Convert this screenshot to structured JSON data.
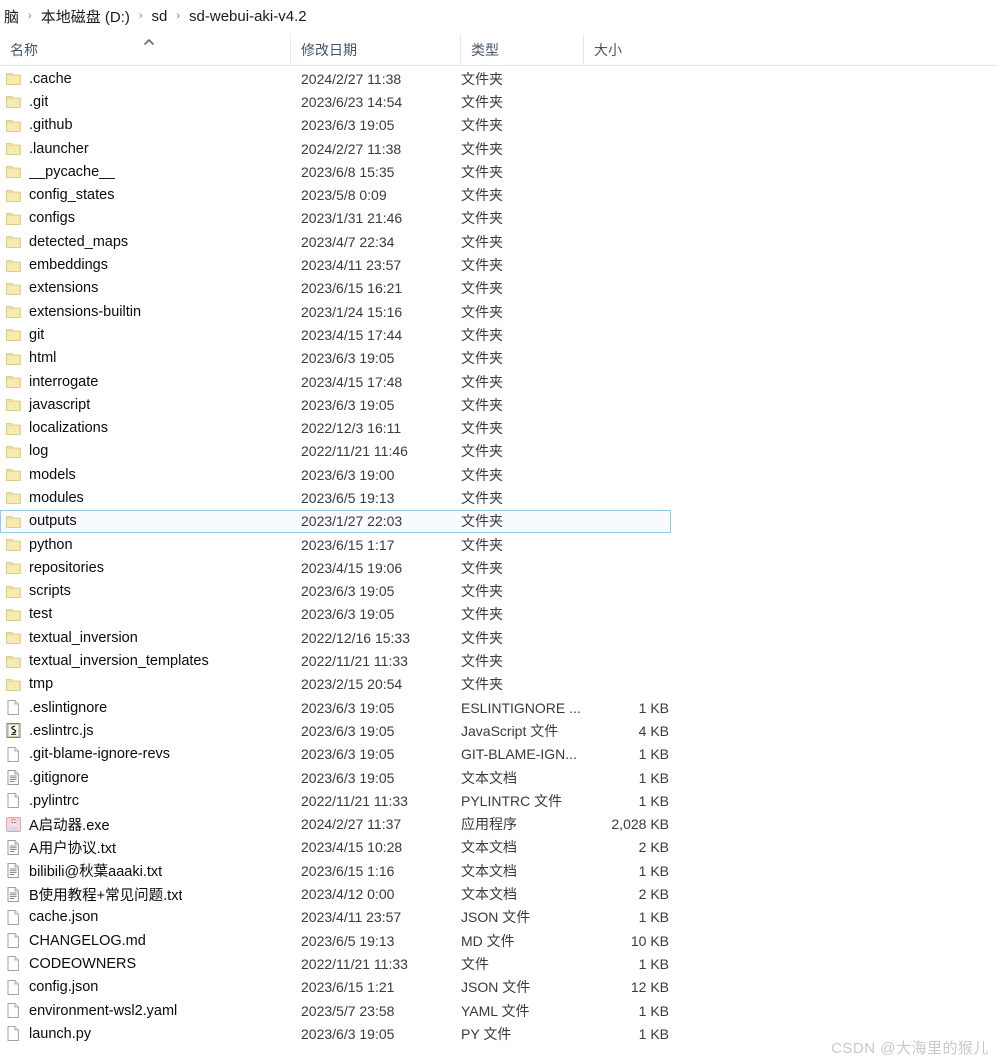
{
  "breadcrumb": {
    "separator": "›",
    "items": [
      {
        "label": "脑"
      },
      {
        "label": "本地磁盘 (D:)"
      },
      {
        "label": "sd"
      },
      {
        "label": "sd-webui-aki-v4.2"
      }
    ]
  },
  "columns": [
    {
      "key": "name",
      "label": "名称"
    },
    {
      "key": "date",
      "label": "修改日期"
    },
    {
      "key": "type",
      "label": "类型"
    },
    {
      "key": "size",
      "label": "大小"
    }
  ],
  "sort": {
    "column": "名称",
    "direction": "asc",
    "icon": "caret-up-icon"
  },
  "colors": {
    "folder": "#f5e6a8",
    "folder_border": "#dcc96b",
    "selection_border": "#9ac9e3",
    "selection_fill": "#f7fbfd",
    "header_text": "#44546a",
    "watermark": "#c9c9c9"
  },
  "rows": [
    {
      "name": ".cache",
      "date": "2024/2/27 11:38",
      "type": "文件夹",
      "size": "",
      "icon": "folder-icon",
      "selected": false
    },
    {
      "name": ".git",
      "date": "2023/6/23 14:54",
      "type": "文件夹",
      "size": "",
      "icon": "folder-icon",
      "selected": false
    },
    {
      "name": ".github",
      "date": "2023/6/3 19:05",
      "type": "文件夹",
      "size": "",
      "icon": "folder-icon",
      "selected": false
    },
    {
      "name": ".launcher",
      "date": "2024/2/27 11:38",
      "type": "文件夹",
      "size": "",
      "icon": "folder-icon",
      "selected": false
    },
    {
      "name": "__pycache__",
      "date": "2023/6/8 15:35",
      "type": "文件夹",
      "size": "",
      "icon": "folder-icon",
      "selected": false
    },
    {
      "name": "config_states",
      "date": "2023/5/8 0:09",
      "type": "文件夹",
      "size": "",
      "icon": "folder-icon",
      "selected": false
    },
    {
      "name": "configs",
      "date": "2023/1/31 21:46",
      "type": "文件夹",
      "size": "",
      "icon": "folder-icon",
      "selected": false
    },
    {
      "name": "detected_maps",
      "date": "2023/4/7 22:34",
      "type": "文件夹",
      "size": "",
      "icon": "folder-icon",
      "selected": false
    },
    {
      "name": "embeddings",
      "date": "2023/4/11 23:57",
      "type": "文件夹",
      "size": "",
      "icon": "folder-icon",
      "selected": false
    },
    {
      "name": "extensions",
      "date": "2023/6/15 16:21",
      "type": "文件夹",
      "size": "",
      "icon": "folder-icon",
      "selected": false
    },
    {
      "name": "extensions-builtin",
      "date": "2023/1/24 15:16",
      "type": "文件夹",
      "size": "",
      "icon": "folder-icon",
      "selected": false
    },
    {
      "name": "git",
      "date": "2023/4/15 17:44",
      "type": "文件夹",
      "size": "",
      "icon": "folder-icon",
      "selected": false
    },
    {
      "name": "html",
      "date": "2023/6/3 19:05",
      "type": "文件夹",
      "size": "",
      "icon": "folder-icon",
      "selected": false
    },
    {
      "name": "interrogate",
      "date": "2023/4/15 17:48",
      "type": "文件夹",
      "size": "",
      "icon": "folder-icon",
      "selected": false
    },
    {
      "name": "javascript",
      "date": "2023/6/3 19:05",
      "type": "文件夹",
      "size": "",
      "icon": "folder-icon",
      "selected": false
    },
    {
      "name": "localizations",
      "date": "2022/12/3 16:11",
      "type": "文件夹",
      "size": "",
      "icon": "folder-icon",
      "selected": false
    },
    {
      "name": "log",
      "date": "2022/11/21 11:46",
      "type": "文件夹",
      "size": "",
      "icon": "folder-icon",
      "selected": false
    },
    {
      "name": "models",
      "date": "2023/6/3 19:00",
      "type": "文件夹",
      "size": "",
      "icon": "folder-icon",
      "selected": false
    },
    {
      "name": "modules",
      "date": "2023/6/5 19:13",
      "type": "文件夹",
      "size": "",
      "icon": "folder-icon",
      "selected": false
    },
    {
      "name": "outputs",
      "date": "2023/1/27 22:03",
      "type": "文件夹",
      "size": "",
      "icon": "folder-icon",
      "selected": true
    },
    {
      "name": "python",
      "date": "2023/6/15 1:17",
      "type": "文件夹",
      "size": "",
      "icon": "folder-icon",
      "selected": false
    },
    {
      "name": "repositories",
      "date": "2023/4/15 19:06",
      "type": "文件夹",
      "size": "",
      "icon": "folder-icon",
      "selected": false
    },
    {
      "name": "scripts",
      "date": "2023/6/3 19:05",
      "type": "文件夹",
      "size": "",
      "icon": "folder-icon",
      "selected": false
    },
    {
      "name": "test",
      "date": "2023/6/3 19:05",
      "type": "文件夹",
      "size": "",
      "icon": "folder-icon",
      "selected": false
    },
    {
      "name": "textual_inversion",
      "date": "2022/12/16 15:33",
      "type": "文件夹",
      "size": "",
      "icon": "folder-icon",
      "selected": false
    },
    {
      "name": "textual_inversion_templates",
      "date": "2022/11/21 11:33",
      "type": "文件夹",
      "size": "",
      "icon": "folder-icon",
      "selected": false
    },
    {
      "name": "tmp",
      "date": "2023/2/15 20:54",
      "type": "文件夹",
      "size": "",
      "icon": "folder-icon",
      "selected": false
    },
    {
      "name": ".eslintignore",
      "date": "2023/6/3 19:05",
      "type": "ESLINTIGNORE ...",
      "size": "1 KB",
      "icon": "blank-file-icon",
      "selected": false
    },
    {
      "name": ".eslintrc.js",
      "date": "2023/6/3 19:05",
      "type": "JavaScript 文件",
      "size": "4 KB",
      "icon": "javascript-file-icon",
      "selected": false
    },
    {
      "name": ".git-blame-ignore-revs",
      "date": "2023/6/3 19:05",
      "type": "GIT-BLAME-IGN...",
      "size": "1 KB",
      "icon": "blank-file-icon",
      "selected": false
    },
    {
      "name": ".gitignore",
      "date": "2023/6/3 19:05",
      "type": "文本文档",
      "size": "1 KB",
      "icon": "text-file-icon",
      "selected": false
    },
    {
      "name": ".pylintrc",
      "date": "2022/11/21 11:33",
      "type": "PYLINTRC 文件",
      "size": "1 KB",
      "icon": "blank-file-icon",
      "selected": false
    },
    {
      "name": "A启动器.exe",
      "date": "2024/2/27 11:37",
      "type": "应用程序",
      "size": "2,028 KB",
      "icon": "application-icon",
      "selected": false
    },
    {
      "name": "A用户协议.txt",
      "date": "2023/4/15 10:28",
      "type": "文本文档",
      "size": "2 KB",
      "icon": "text-file-icon",
      "selected": false
    },
    {
      "name": "bilibili@秋葉aaaki.txt",
      "date": "2023/6/15 1:16",
      "type": "文本文档",
      "size": "1 KB",
      "icon": "text-file-icon",
      "selected": false
    },
    {
      "name": "B使用教程+常见问题.txt",
      "date": "2023/4/12 0:00",
      "type": "文本文档",
      "size": "2 KB",
      "icon": "text-file-icon",
      "selected": false
    },
    {
      "name": "cache.json",
      "date": "2023/4/11 23:57",
      "type": "JSON 文件",
      "size": "1 KB",
      "icon": "blank-file-icon",
      "selected": false
    },
    {
      "name": "CHANGELOG.md",
      "date": "2023/6/5 19:13",
      "type": "MD 文件",
      "size": "10 KB",
      "icon": "blank-file-icon",
      "selected": false
    },
    {
      "name": "CODEOWNERS",
      "date": "2022/11/21 11:33",
      "type": "文件",
      "size": "1 KB",
      "icon": "blank-file-icon",
      "selected": false
    },
    {
      "name": "config.json",
      "date": "2023/6/15 1:21",
      "type": "JSON 文件",
      "size": "12 KB",
      "icon": "blank-file-icon",
      "selected": false
    },
    {
      "name": "environment-wsl2.yaml",
      "date": "2023/5/7 23:58",
      "type": "YAML 文件",
      "size": "1 KB",
      "icon": "blank-file-icon",
      "selected": false
    },
    {
      "name": "launch.py",
      "date": "2023/6/3 19:05",
      "type": "PY 文件",
      "size": "1 KB",
      "icon": "blank-file-icon",
      "selected": false
    }
  ],
  "watermark": "CSDN @大海里的猴儿"
}
